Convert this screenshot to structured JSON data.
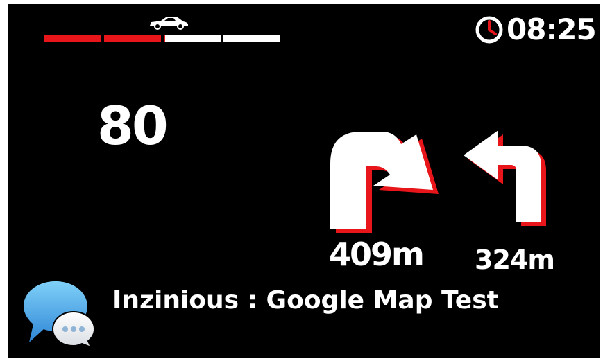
{
  "hud": {
    "clock_time": "08:25",
    "speed": "80",
    "next_turn": {
      "direction": "right",
      "distance": "409m"
    },
    "following_turn": {
      "direction": "left",
      "distance": "324m"
    },
    "notification": {
      "text": "Inzinious : Google Map Test"
    },
    "traffic_bar": {
      "segments": [
        "red",
        "red",
        "white",
        "white"
      ],
      "red_fraction": 0.5
    }
  },
  "icons": {
    "car": "car-icon",
    "clock": "clock-icon",
    "turn_right": "turn-right-arrow-icon",
    "turn_left": "turn-left-arrow-icon",
    "message": "message-bubbles-icon"
  },
  "colors": {
    "background": "#000000",
    "accent_red": "#e8161b",
    "text": "#ffffff",
    "bubble_blue": "#3a9ee0"
  }
}
